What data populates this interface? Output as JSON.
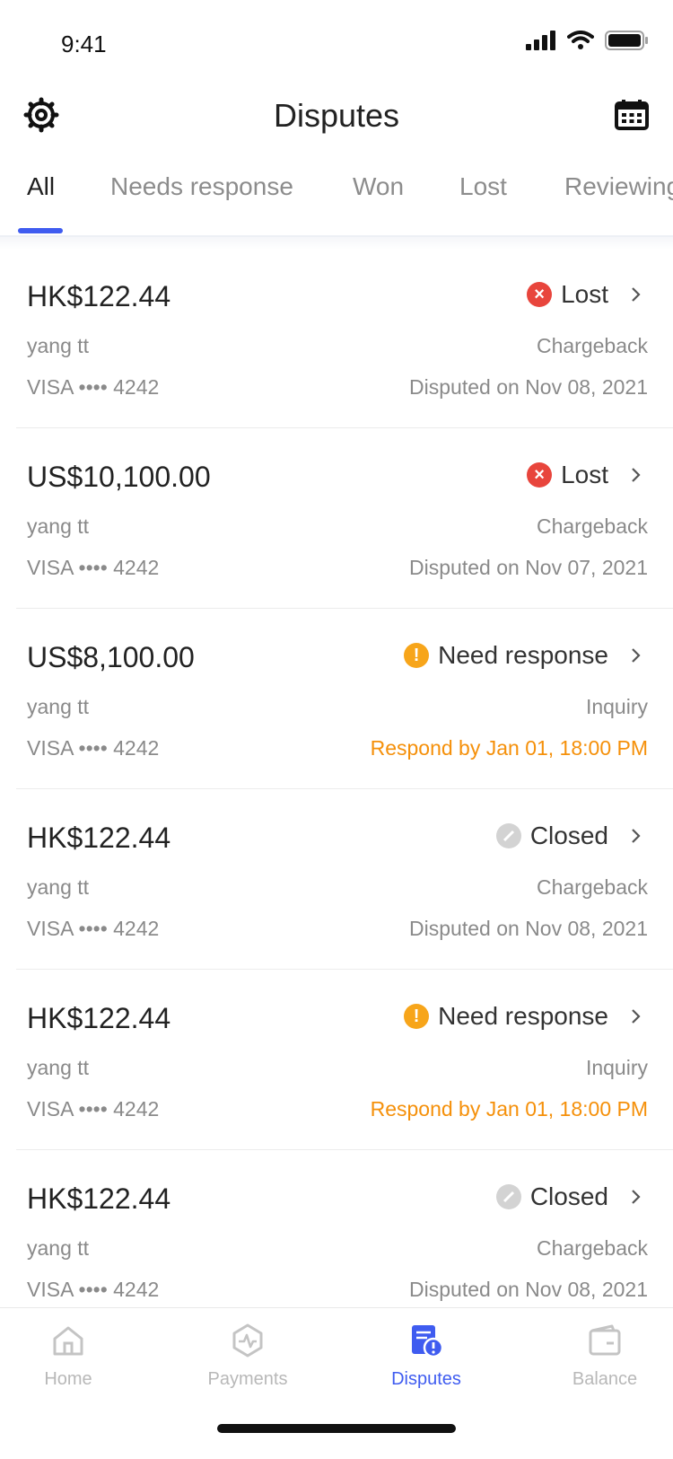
{
  "status_bar": {
    "time": "9:41"
  },
  "header": {
    "title": "Disputes",
    "left_icon": "gear-icon",
    "right_icon": "calendar-icon"
  },
  "tabs": [
    {
      "label": "All",
      "active": true
    },
    {
      "label": "Needs response",
      "active": false
    },
    {
      "label": "Won",
      "active": false
    },
    {
      "label": "Lost",
      "active": false
    },
    {
      "label": "Reviewing",
      "active": false
    }
  ],
  "disputes": [
    {
      "amount": "HK$122.44",
      "status": "Lost",
      "status_type": "lost",
      "customer": "yang tt",
      "dispute_type": "Chargeback",
      "card": "VISA •••• 4242",
      "meta": "Disputed on Nov 08, 2021",
      "urgent": false
    },
    {
      "amount": "US$10,100.00",
      "status": "Lost",
      "status_type": "lost",
      "customer": "yang tt",
      "dispute_type": "Chargeback",
      "card": "VISA •••• 4242",
      "meta": "Disputed on Nov 07, 2021",
      "urgent": false
    },
    {
      "amount": "US$8,100.00",
      "status": "Need response",
      "status_type": "need",
      "customer": "yang tt",
      "dispute_type": "Inquiry",
      "card": "VISA •••• 4242",
      "meta": "Respond by Jan 01, 18:00 PM",
      "urgent": true
    },
    {
      "amount": "HK$122.44",
      "status": "Closed",
      "status_type": "closed",
      "customer": "yang tt",
      "dispute_type": "Chargeback",
      "card": "VISA •••• 4242",
      "meta": "Disputed on Nov 08, 2021",
      "urgent": false
    },
    {
      "amount": "HK$122.44",
      "status": "Need response",
      "status_type": "need",
      "customer": "yang tt",
      "dispute_type": "Inquiry",
      "card": "VISA •••• 4242",
      "meta": "Respond by Jan 01, 18:00 PM",
      "urgent": true
    },
    {
      "amount": "HK$122.44",
      "status": "Closed",
      "status_type": "closed",
      "customer": "yang tt",
      "dispute_type": "Chargeback",
      "card": "VISA •••• 4242",
      "meta": "Disputed on Nov 08, 2021",
      "urgent": false
    }
  ],
  "bottom_nav": [
    {
      "label": "Home",
      "icon": "home-icon",
      "active": false
    },
    {
      "label": "Payments",
      "icon": "payments-icon",
      "active": false
    },
    {
      "label": "Disputes",
      "icon": "disputes-icon",
      "active": true
    },
    {
      "label": "Balance",
      "icon": "wallet-icon",
      "active": false
    }
  ],
  "colors": {
    "accent": "#3f5cf0",
    "lost": "#e8453c",
    "need_response": "#f7a51a",
    "urgent_text": "#f5900a",
    "closed": "#d3d3d3"
  }
}
